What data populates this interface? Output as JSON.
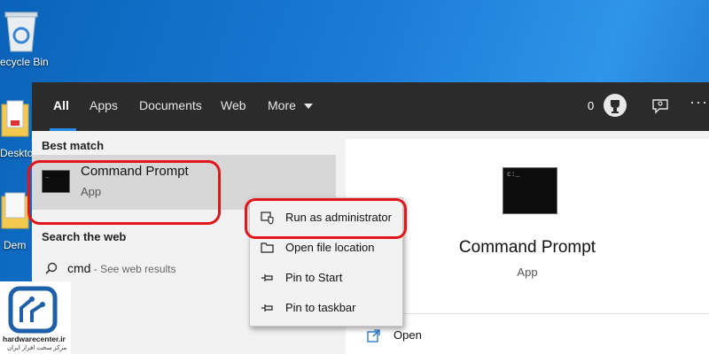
{
  "desktop": {
    "recycle_bin_label": "ecycle Bin",
    "desktop_label": "Deskto",
    "demo_label": "Dem"
  },
  "tabs": [
    "All",
    "Apps",
    "Documents",
    "Web",
    "More"
  ],
  "topbar": {
    "points": "0"
  },
  "left": {
    "best_match_heading": "Best match",
    "best_match_title": "Command Prompt",
    "best_match_subtitle": "App",
    "search_web_heading": "Search the web",
    "web_query": "cmd",
    "web_query_suffix": " - See web results"
  },
  "context_menu": [
    {
      "label": "Run as administrator",
      "icon": "shield-icon"
    },
    {
      "label": "Open file location",
      "icon": "folder-open-icon"
    },
    {
      "label": "Pin to Start",
      "icon": "pin-icon"
    },
    {
      "label": "Pin to taskbar",
      "icon": "pin-icon"
    }
  ],
  "right": {
    "title": "Command Prompt",
    "subtitle": "App",
    "open_label": "Open"
  },
  "watermark": {
    "site": "hardwarecenter.ir",
    "tagline": "مرکز سخت افزار ایران"
  },
  "colors": {
    "accent": "#2b8be6",
    "highlight_ring": "#e1151a",
    "logo_blue": "#1d5fa8"
  }
}
